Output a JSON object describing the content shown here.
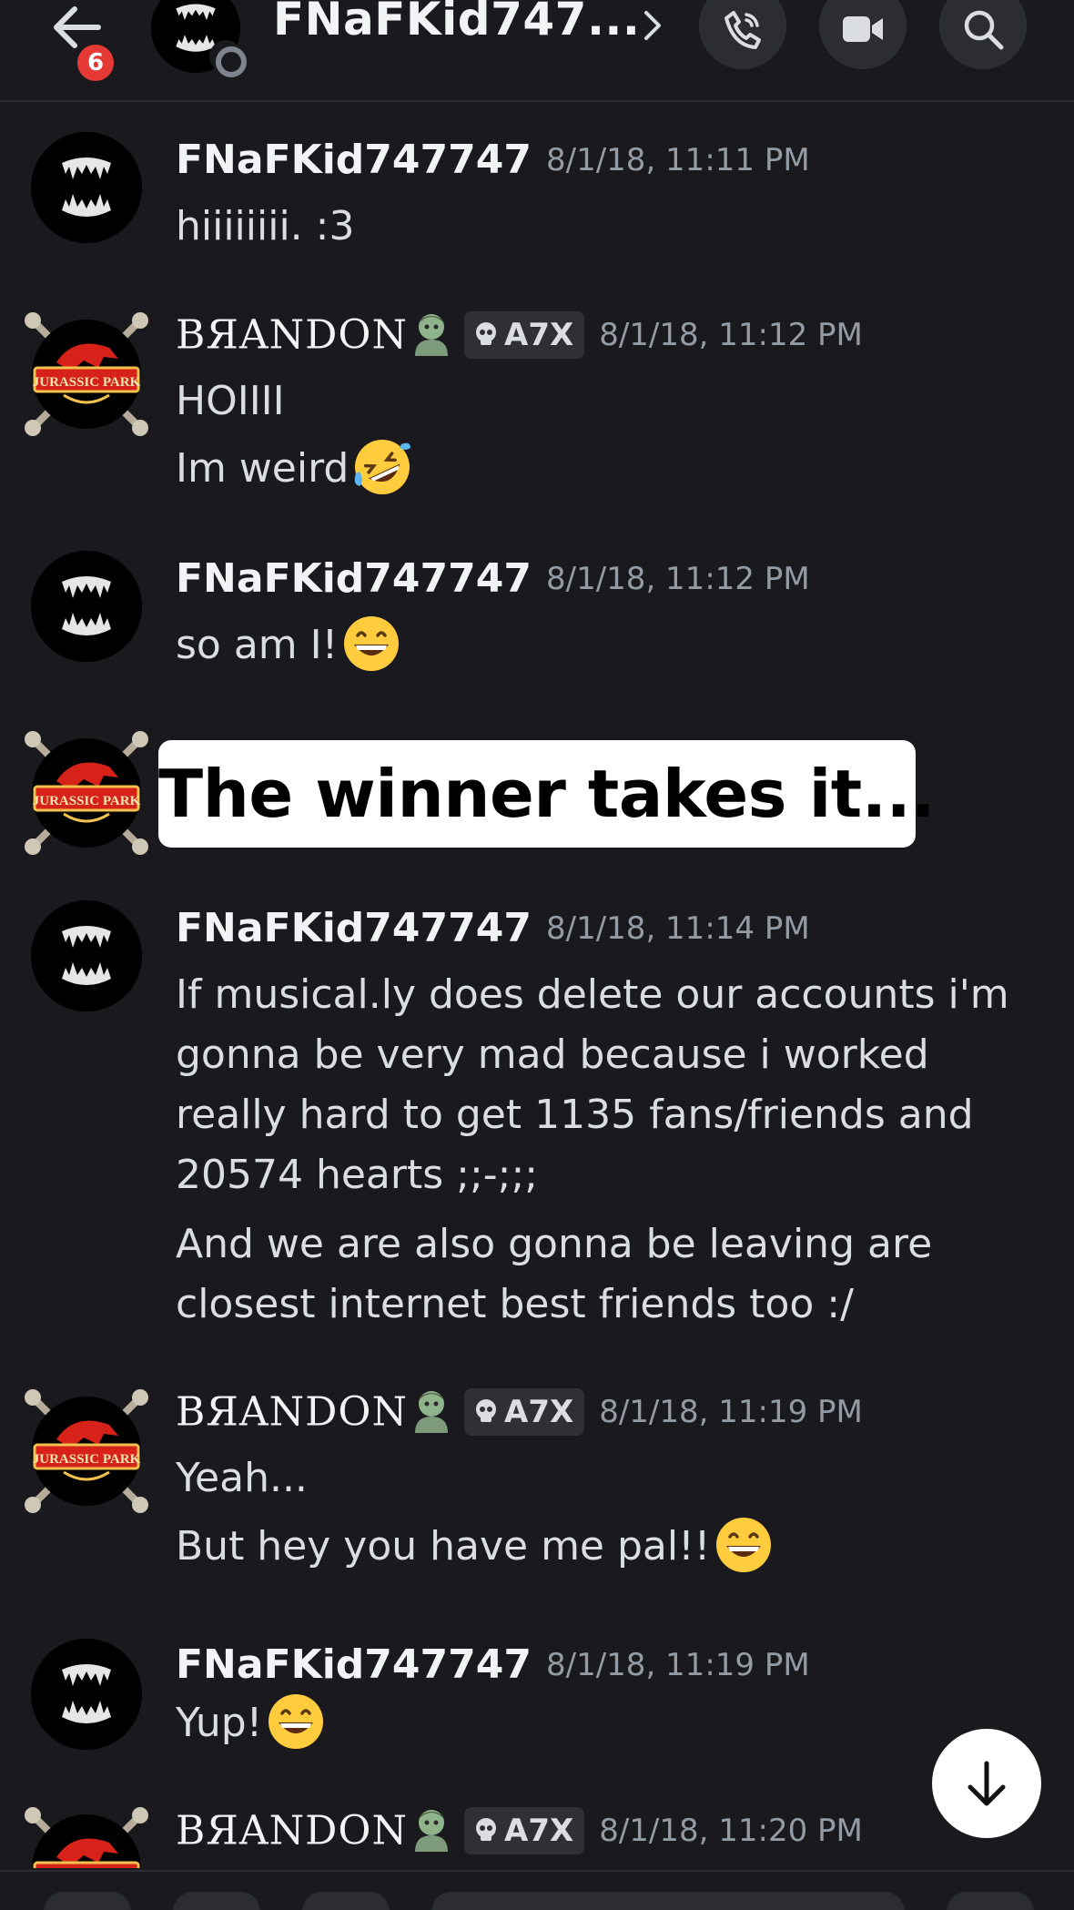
{
  "header": {
    "unread_count": "6",
    "title": "FNaFKid747...",
    "icons": [
      "back-arrow-icon",
      "chevron-right-icon",
      "phone-call-icon",
      "video-camera-icon",
      "search-icon"
    ]
  },
  "messages": [
    {
      "author": "FNaFKid747747",
      "timestamp": "8/1/18, 11:11 PM",
      "lines": [
        "hiiiiiiii. :3"
      ]
    },
    {
      "author": "BЯANDON",
      "tag": "A7X",
      "timestamp": "8/1/18, 11:12 PM",
      "lines": [
        "HOIIII",
        "Im weird"
      ]
    },
    {
      "author": "FNaFKid747747",
      "timestamp": "8/1/18, 11:12 PM",
      "lines": [
        "so am I!"
      ]
    },
    {
      "author": "FNaFKid747747",
      "timestamp": "8/1/18, 11:14 PM",
      "lines": [
        "If musical.ly does delete our accounts i'm gonna be very mad because i worked really hard to get 1135 fans/friends and 20574 hearts ;;-;;;",
        "And we are also gonna be leaving are closest internet best friends too  :/"
      ]
    },
    {
      "author": "BЯANDON",
      "tag": "A7X",
      "timestamp": "8/1/18, 11:19 PM",
      "lines": [
        "Yeah...",
        "But hey you have me pal!!"
      ]
    },
    {
      "author": "FNaFKid747747",
      "timestamp": "8/1/18, 11:19 PM",
      "lines": [
        "Yup!"
      ]
    },
    {
      "author": "BЯANDON",
      "tag": "A7X",
      "timestamp": "8/1/18, 11:20 PM",
      "lines": []
    }
  ],
  "overlay_caption": "The winner takes it...",
  "jp_badge_text": "JURASSIC PARK",
  "colors": {
    "background": "#1a1a1e",
    "text_primary": "#f2f3f5",
    "text_secondary": "#949ba4",
    "badge_red": "#e53935",
    "tag_bg": "#2e3035"
  }
}
